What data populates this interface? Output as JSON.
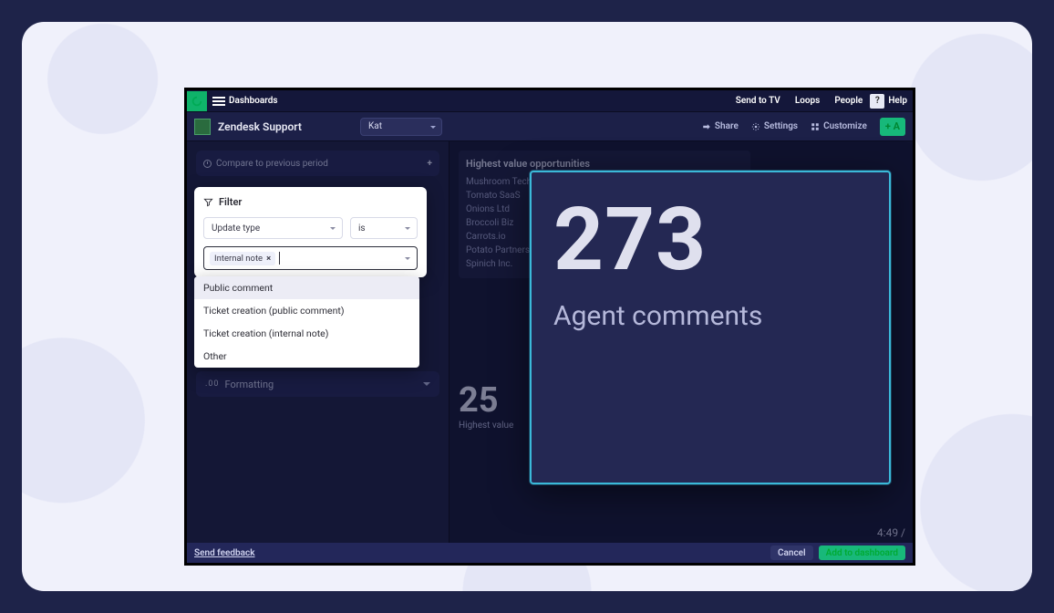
{
  "topbar": {
    "title": "Dashboards",
    "links": {
      "sendtv": "Send to TV",
      "loops": "Loops",
      "people": "People",
      "q": "?",
      "help": "Help"
    }
  },
  "subhead": {
    "integration": "Zendesk Support",
    "user": "Kat",
    "tools": {
      "share": "Share",
      "settings": "Settings",
      "customize": "Customize",
      "add": "+  A"
    }
  },
  "compare": {
    "label": "Compare to previous period",
    "plus": "+"
  },
  "filter": {
    "title": "Filter",
    "field": "Update type",
    "operator": "is",
    "chip": "Internal note",
    "options": [
      "Public comment",
      "Ticket creation (public comment)",
      "Ticket creation (internal note)",
      "Other"
    ]
  },
  "formatting": {
    "prefix": ".00",
    "label": "Formatting"
  },
  "opps": {
    "title": "Highest value opportunities",
    "rows": [
      "Mushroom Tech",
      "Tomato SaaS",
      "Onions Ltd",
      "Broccoli Biz",
      "Carrots.io",
      "Potato Partners",
      "Spinich Inc."
    ]
  },
  "small_stat": {
    "value": "25",
    "label": "Highest value"
  },
  "spotlight": {
    "value": "273",
    "label": "Agent comments"
  },
  "timecode": "4:49 /",
  "footer": {
    "feedback": "Send feedback",
    "cancel": "Cancel",
    "add": "Add to dashboard"
  }
}
